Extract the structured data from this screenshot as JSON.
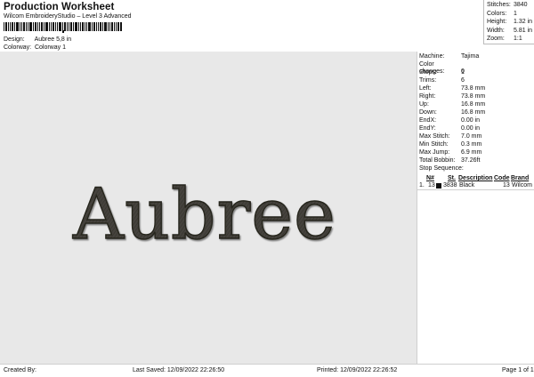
{
  "header": {
    "title": "Production Worksheet",
    "subtitle": "Wilcom EmbroideryStudio – Level 3 Advanced",
    "design_label": "Design:",
    "design_value": "Aubree 5,8 in",
    "colorway_label": "Colorway:",
    "colorway_value": "Colorway 1"
  },
  "stats": {
    "stitches_label": "Stitches:",
    "stitches_value": "3840",
    "colors_label": "Colors:",
    "colors_value": "1",
    "height_label": "Height:",
    "height_value": "1.32 in",
    "width_label": "Width:",
    "width_value": "5.81 in",
    "zoom_label": "Zoom:",
    "zoom_value": "1:1"
  },
  "design": {
    "text": "Aubree",
    "thread_color": "#45433c",
    "canvas_color": "#e8e8e8"
  },
  "machine": {
    "items": [
      {
        "label": "Machine:",
        "value": "Tajima"
      },
      {
        "label": "Color changes:",
        "value": "0"
      },
      {
        "label": "Stops:",
        "value": "1"
      },
      {
        "label": "Trims:",
        "value": "6"
      },
      {
        "label": "Left:",
        "value": "73.8 mm"
      },
      {
        "label": "Right:",
        "value": "73.8 mm"
      },
      {
        "label": "Up:",
        "value": "16.8 mm"
      },
      {
        "label": "Down:",
        "value": "16.8 mm"
      },
      {
        "label": "EndX:",
        "value": "0.00 in"
      },
      {
        "label": "EndY:",
        "value": "0.00 in"
      },
      {
        "label": "Max Stitch:",
        "value": "7.0 mm"
      },
      {
        "label": "Min Stitch:",
        "value": "0.3 mm"
      },
      {
        "label": "Max Jump:",
        "value": "6.9 mm"
      },
      {
        "label": "Total Bobbin:",
        "value": "37.26ft"
      }
    ]
  },
  "stop_sequence": {
    "label": "Stop Sequence:",
    "columns": {
      "n": "N#",
      "st": "St.",
      "description": "Description",
      "code": "Code",
      "brand": "Brand"
    },
    "rows": [
      {
        "index": "1.",
        "n": "13",
        "st": "3838",
        "description": "Black",
        "code": "13",
        "brand": "Wilcom",
        "color": "#111111"
      }
    ]
  },
  "footer": {
    "created_by": "Created By:",
    "last_saved": "Last Saved: 12/09/2022 22:26:50",
    "printed": "Printed: 12/09/2022 22:26:52",
    "page": "Page 1 of 1"
  }
}
